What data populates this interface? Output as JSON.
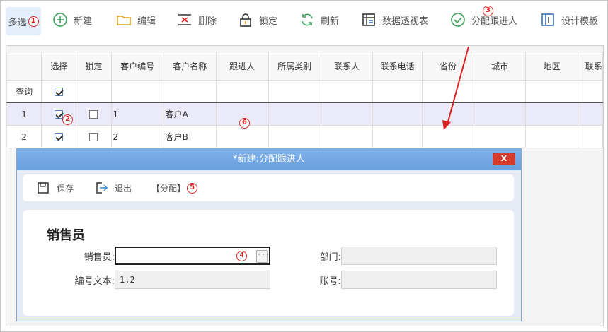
{
  "toolbar": {
    "multi_select": "多选",
    "new": "新建",
    "edit": "编辑",
    "delete": "删除",
    "lock": "锁定",
    "refresh": "刷新",
    "pivot": "数据透视表",
    "assign": "分配跟进人",
    "design": "设计模板"
  },
  "badges": {
    "b1": "1",
    "b2": "2",
    "b3": "3",
    "b4": "4",
    "b5": "5",
    "b6": "6"
  },
  "grid": {
    "columns": [
      "选择",
      "锁定",
      "客户编号",
      "客户名称",
      "跟进人",
      "所属类别",
      "联系人",
      "联系电话",
      "省份",
      "城市",
      "地区",
      "联系"
    ],
    "query_label": "查询",
    "rows": [
      {
        "num": "1",
        "code": "1",
        "name": "客户A"
      },
      {
        "num": "2",
        "code": "2",
        "name": "客户B"
      }
    ]
  },
  "dialog": {
    "title": "*新建:分配跟进人",
    "close": "X",
    "save": "保存",
    "exit": "退出",
    "assign": "【分配】",
    "section": "销售员",
    "fields": {
      "salesman_label": "销售员:",
      "salesman_value": "",
      "code_text_label": "编号文本:",
      "code_text_value": "1,2",
      "dept_label": "部门:",
      "dept_value": "",
      "account_label": "账号:",
      "account_value": ""
    },
    "picker": "···"
  },
  "colors": {
    "accent": "#e02020",
    "title_bar": "#6aa0e0",
    "close": "#d63a2a",
    "selected_row": "#eaeaf8"
  }
}
